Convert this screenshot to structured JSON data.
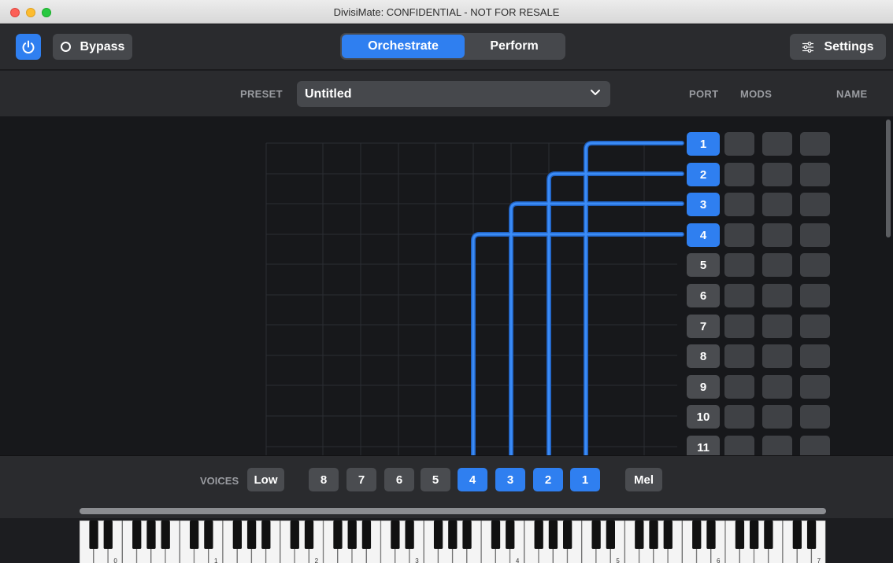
{
  "window": {
    "title": "DivisiMate: CONFIDENTIAL - NOT FOR RESALE"
  },
  "toolbar": {
    "power_icon": "power-icon",
    "bypass_label": "Bypass",
    "modes": {
      "orchestrate": "Orchestrate",
      "perform": "Perform",
      "selected": "Orchestrate"
    },
    "settings_label": "Settings",
    "settings_icon": "sliders-icon"
  },
  "preset": {
    "label": "PRESET",
    "value": "Untitled"
  },
  "columns": {
    "port": "PORT",
    "mods": "MODS",
    "name": "NAME"
  },
  "ports": [
    {
      "label": "1",
      "active": true
    },
    {
      "label": "2",
      "active": true
    },
    {
      "label": "3",
      "active": true
    },
    {
      "label": "4",
      "active": true
    },
    {
      "label": "5",
      "active": false
    },
    {
      "label": "6",
      "active": false
    },
    {
      "label": "7",
      "active": false
    },
    {
      "label": "8",
      "active": false
    },
    {
      "label": "9",
      "active": false
    },
    {
      "label": "10",
      "active": false
    },
    {
      "label": "11",
      "active": false
    }
  ],
  "voices": {
    "label": "VOICES",
    "low_label": "Low",
    "mel_label": "Mel",
    "buttons": [
      {
        "label": "8",
        "active": false
      },
      {
        "label": "7",
        "active": false
      },
      {
        "label": "6",
        "active": false
      },
      {
        "label": "5",
        "active": false
      },
      {
        "label": "4",
        "active": true
      },
      {
        "label": "3",
        "active": true
      },
      {
        "label": "2",
        "active": true
      },
      {
        "label": "1",
        "active": true
      }
    ]
  },
  "routing": [
    {
      "voice": "1",
      "port": "1"
    },
    {
      "voice": "2",
      "port": "2"
    },
    {
      "voice": "3",
      "port": "3"
    },
    {
      "voice": "4",
      "port": "4"
    }
  ],
  "keyboard": {
    "octave_labels": [
      "0",
      "1",
      "2",
      "3",
      "4",
      "5",
      "6",
      "7"
    ]
  },
  "colors": {
    "accent": "#2f7ff0",
    "button": "#4a4c50",
    "background": "#17181b",
    "panel": "#2a2b2e"
  }
}
